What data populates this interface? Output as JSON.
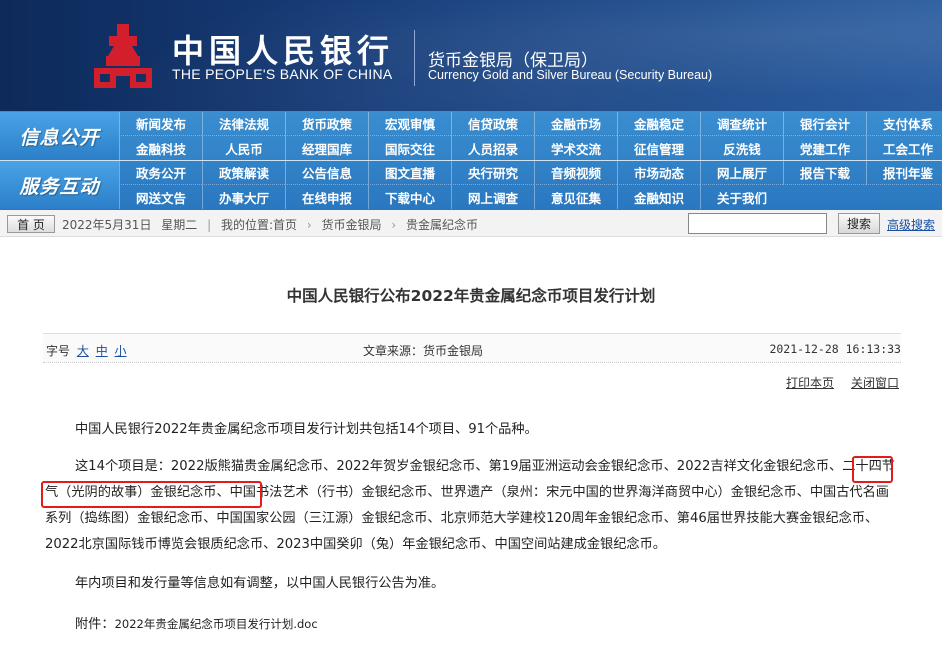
{
  "header": {
    "bank_cn": "中国人民银行",
    "bank_en": "THE PEOPLE'S BANK OF CHINA",
    "bureau_cn": "货币金银局（保卫局）",
    "bureau_en": "Currency Gold and Silver Bureau (Security Bureau)",
    "logo_color": "#d21f2b"
  },
  "nav": {
    "section1_title": "信息公开",
    "section1_row1": [
      "新闻发布",
      "法律法规",
      "货币政策",
      "宏观审慎",
      "信贷政策",
      "金融市场",
      "金融稳定",
      "调查统计",
      "银行会计",
      "支付体系"
    ],
    "section1_row2": [
      "金融科技",
      "人民币",
      "经理国库",
      "国际交往",
      "人员招录",
      "学术交流",
      "征信管理",
      "反洗钱",
      "党建工作",
      "工会工作"
    ],
    "section2_title": "服务互动",
    "section2_row1": [
      "政务公开",
      "政策解读",
      "公告信息",
      "图文直播",
      "央行研究",
      "音频视频",
      "市场动态",
      "网上展厅",
      "报告下载",
      "报刊年鉴"
    ],
    "section2_row2": [
      "网送文告",
      "办事大厅",
      "在线申报",
      "下载中心",
      "网上调查",
      "意见征集",
      "金融知识",
      "关于我们"
    ]
  },
  "breadcrumb": {
    "home_label": "首 页",
    "date": "2022年5月31日",
    "weekday": "星期二",
    "location_prefix": "我的位置:",
    "items": [
      "首页",
      "货币金银局",
      "贵金属纪念币"
    ],
    "search_placeholder": "",
    "search_label": "搜索",
    "advanced_search": "高级搜索"
  },
  "article": {
    "title": "中国人民银行公布2022年贵金属纪念币项目发行计划",
    "font_size_label": "字号",
    "font_large": "大",
    "font_medium": "中",
    "font_small": "小",
    "source": "文章来源：货币金银局",
    "datetime": "2021-12-28 16:13:33",
    "print": "打印本页",
    "close": "关闭窗口",
    "p1": "中国人民银行2022年贵金属纪念币项目发行计划共包括14个项目、91个品种。",
    "p2_a": "这14个项目是：2022版熊猫贵金属纪念币、2022年贺岁金银纪念币、第19届亚洲运动会金银纪念币、2022吉祥文化金银纪念币、",
    "p2_hl": "二十四节气（光阴的故事）金银纪念币",
    "p2_b": "、中国书法艺术（行书）金银纪念币、世界遗产（泉州：宋元中国的世界海洋商贸中心）金银纪念币、中国古代名画系列（捣练图）金银纪念币、中国国家公园（三江源）金银纪念币、北京师范大学建校120周年金银纪念币、第46届世界技能大赛金银纪念币、2022北京国际钱币博览会银质纪念币、2023中国癸卯（兔）年金银纪念币、中国空间站建成金银纪念币。",
    "p3": "年内项目和发行量等信息如有调整，以中国人民银行公告为准。",
    "attach_label": "附件：",
    "attach_file": "2022年贵金属纪念币项目发行计划.doc",
    "highlight_color": "#e21b1b"
  }
}
